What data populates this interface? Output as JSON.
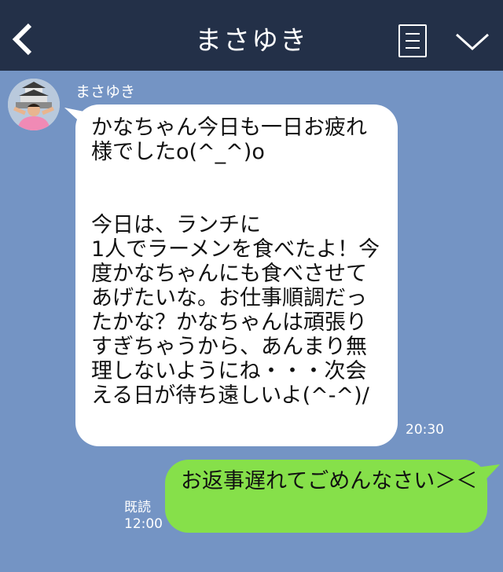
{
  "header": {
    "title": "まさゆき",
    "back_icon": "chevron-left-icon",
    "menu_icon": "list-menu-icon",
    "dropdown_icon": "chevron-down-icon"
  },
  "messages": {
    "incoming": {
      "sender": "まさゆき",
      "text": "かなちゃん今日も一日お疲れ様でしたo(^_^)o\n\n\n今日は、ランチに\n1人でラーメンを食べたよ！今度かなちゃんにも食べさせてあげたいな。お仕事順調だったかな？かなちゃんは頑張りすぎちゃうから、あんまり無理しないようにね・・・次会える日が待ち遠しいよ(^-^)/",
      "time": "20:30"
    },
    "outgoing": {
      "text": "お返事遅れてごめんなさい＞＜",
      "read_label": "既読",
      "time": "12:00"
    }
  },
  "colors": {
    "background": "#7494c4",
    "header": "#233048",
    "incoming_bubble": "#ffffff",
    "outgoing_bubble": "#86e04a"
  }
}
